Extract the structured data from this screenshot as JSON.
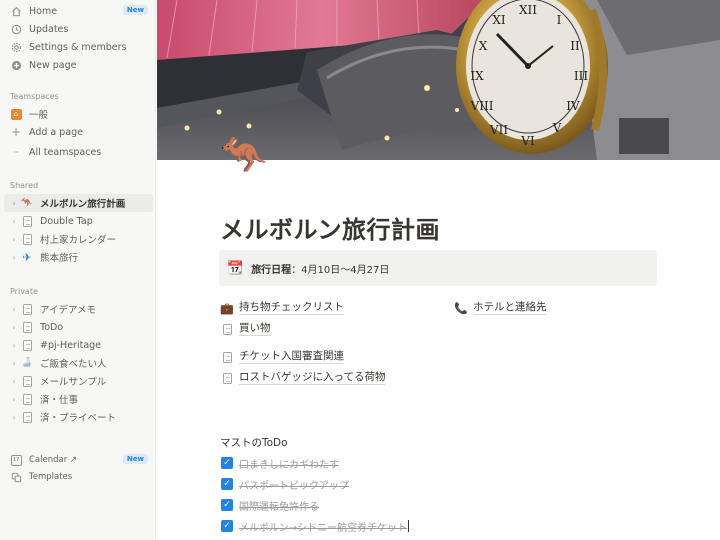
{
  "sidebar": {
    "top": [
      {
        "label": "Home",
        "icon": "home-icon",
        "badge": "New"
      },
      {
        "label": "Updates",
        "icon": "clock-icon"
      },
      {
        "label": "Settings & members",
        "icon": "gear-icon"
      },
      {
        "label": "New page",
        "icon": "plus-circle-icon"
      }
    ],
    "teamspaces_title": "Teamspaces",
    "teamspaces": [
      {
        "label": "一般",
        "icon": "house-emoji-icon",
        "glyph": "⌂"
      },
      {
        "label": "Add a page",
        "icon": "plus-icon",
        "glyph": "+"
      },
      {
        "label": "All teamspaces",
        "icon": "more-icon",
        "glyph": "···"
      }
    ],
    "shared_title": "Shared",
    "shared": [
      {
        "label": "メルボルン旅行計画",
        "icon": "kangaroo-icon",
        "glyph": "🦘",
        "active": true
      },
      {
        "label": "Double Tap",
        "icon": "page-icon"
      },
      {
        "label": "村上家カレンダー",
        "icon": "page-icon"
      },
      {
        "label": "熊本旅行",
        "icon": "airplane-icon",
        "glyph": "✈"
      }
    ],
    "private_title": "Private",
    "private": [
      {
        "label": "アイデアメモ",
        "icon": "page-icon"
      },
      {
        "label": "ToDo",
        "icon": "page-icon"
      },
      {
        "label": "#pj-Heritage",
        "icon": "page-icon"
      },
      {
        "label": "ご飯食べたい人",
        "icon": "food-icon",
        "glyph": "🍶"
      },
      {
        "label": "メールサンプル",
        "icon": "page-icon"
      },
      {
        "label": "済・仕事",
        "icon": "page-icon"
      },
      {
        "label": "済・プライベート",
        "icon": "page-icon"
      }
    ],
    "bottom": [
      {
        "label": "Calendar ↗",
        "icon": "calendar-icon",
        "badge": "New"
      },
      {
        "label": "Templates",
        "icon": "templates-icon"
      }
    ]
  },
  "page": {
    "icon": "🦘",
    "title": "メルボルン旅行計画",
    "callout": {
      "icon": "📆",
      "label": "旅行日程",
      "value": "：4月10日〜4月27日"
    },
    "links_left": [
      {
        "label": "持ち物チェックリスト",
        "icon": "briefcase-icon",
        "glyph": "💼"
      },
      {
        "label": "買い物",
        "icon": "page-icon"
      },
      {
        "label": "チケット入国審査関連",
        "icon": "page-icon"
      },
      {
        "label": "ロストバゲッジに入ってる荷物",
        "icon": "page-icon"
      }
    ],
    "link_right": {
      "label": "ホテルと連絡先",
      "icon": "phone-icon",
      "glyph": "📞"
    },
    "todo_heading": "マストのToDo",
    "todos": [
      {
        "label": "口まきしにカギわたす",
        "checked": true
      },
      {
        "label": "パスポートピックアップ",
        "checked": true
      },
      {
        "label": "国際運転免許作る",
        "checked": true
      },
      {
        "label": "メルボルン→シドニー航空券チケット",
        "checked": true
      }
    ]
  },
  "colors": {
    "accent": "#2383e2",
    "sidebar_bg": "#f7f7f5",
    "callout_bg": "#f1f1ef"
  }
}
